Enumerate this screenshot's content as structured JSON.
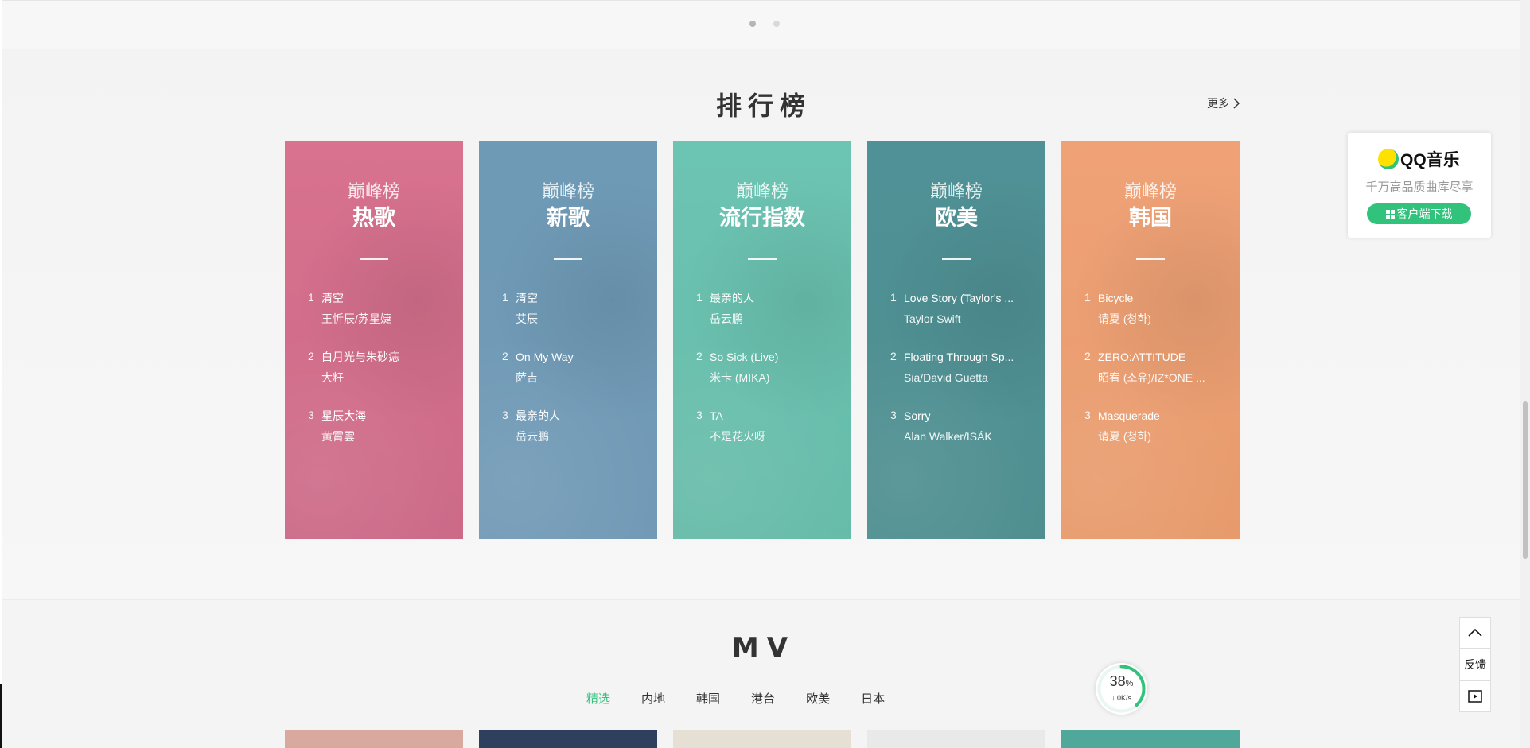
{
  "carousel": {
    "dot_count": 2,
    "active_index": 0
  },
  "ranking": {
    "title": "排行榜",
    "more_label": "更多",
    "cards": [
      {
        "subtitle": "巅峰榜",
        "name": "热歌",
        "color_top": "#d8728e",
        "color_bottom": "#cc6a88",
        "songs": [
          {
            "rank": "1",
            "title": "清空",
            "artist": "王忻辰/苏星婕"
          },
          {
            "rank": "2",
            "title": "白月光与朱砂痣",
            "artist": "大籽"
          },
          {
            "rank": "3",
            "title": "星辰大海",
            "artist": "黄霄雲"
          }
        ]
      },
      {
        "subtitle": "巅峰榜",
        "name": "新歌",
        "color_top": "#6e9ab6",
        "color_bottom": "#729ab6",
        "songs": [
          {
            "rank": "1",
            "title": "清空",
            "artist": "艾辰"
          },
          {
            "rank": "2",
            "title": "On My Way",
            "artist": "萨吉"
          },
          {
            "rank": "3",
            "title": "最亲的人",
            "artist": "岳云鹏"
          }
        ]
      },
      {
        "subtitle": "巅峰榜",
        "name": "流行指数",
        "color_top": "#6cc4b2",
        "color_bottom": "#67bba9",
        "songs": [
          {
            "rank": "1",
            "title": "最亲的人",
            "artist": "岳云鹏"
          },
          {
            "rank": "2",
            "title": "So Sick (Live)",
            "artist": "米卡 (MIKA)"
          },
          {
            "rank": "3",
            "title": "TA",
            "artist": "不是花火呀"
          }
        ]
      },
      {
        "subtitle": "巅峰榜",
        "name": "欧美",
        "color_top": "#4f9196",
        "color_bottom": "#4f8f90",
        "songs": [
          {
            "rank": "1",
            "title": "Love Story (Taylor's ...",
            "artist": "Taylor Swift"
          },
          {
            "rank": "2",
            "title": "Floating Through Sp...",
            "artist": "Sia/David Guetta"
          },
          {
            "rank": "3",
            "title": "Sorry",
            "artist": "Alan Walker/ISÁK"
          }
        ]
      },
      {
        "subtitle": "巅峰榜",
        "name": "韩国",
        "color_top": "#f0a277",
        "color_bottom": "#e79b6c",
        "songs": [
          {
            "rank": "1",
            "title": "Bicycle",
            "artist": "请夏 (청하)"
          },
          {
            "rank": "2",
            "title": "ZERO:ATTITUDE",
            "artist": "昭宥 (소유)/IZ*ONE ..."
          },
          {
            "rank": "3",
            "title": "Masquerade",
            "artist": "请夏 (청하)"
          }
        ]
      }
    ]
  },
  "mv": {
    "title": "MV",
    "tabs": [
      "精选",
      "内地",
      "韩国",
      "港台",
      "欧美",
      "日本"
    ],
    "active_tab": 0,
    "thumb_colors": [
      "#d9a89e",
      "#2f3f5e",
      "#e6e0d4",
      "#e9e9e9",
      "#4fa89a"
    ]
  },
  "qq_ad": {
    "brand": "QQ音乐",
    "slogan": "千万高品质曲库尽享",
    "download_label": "客户端下载"
  },
  "speed_ball": {
    "percent": "38",
    "percent_sign": "%",
    "rate": "0K/s"
  },
  "side_tools": {
    "feedback_label": "反馈"
  },
  "colors": {
    "accent": "#31c27c"
  }
}
